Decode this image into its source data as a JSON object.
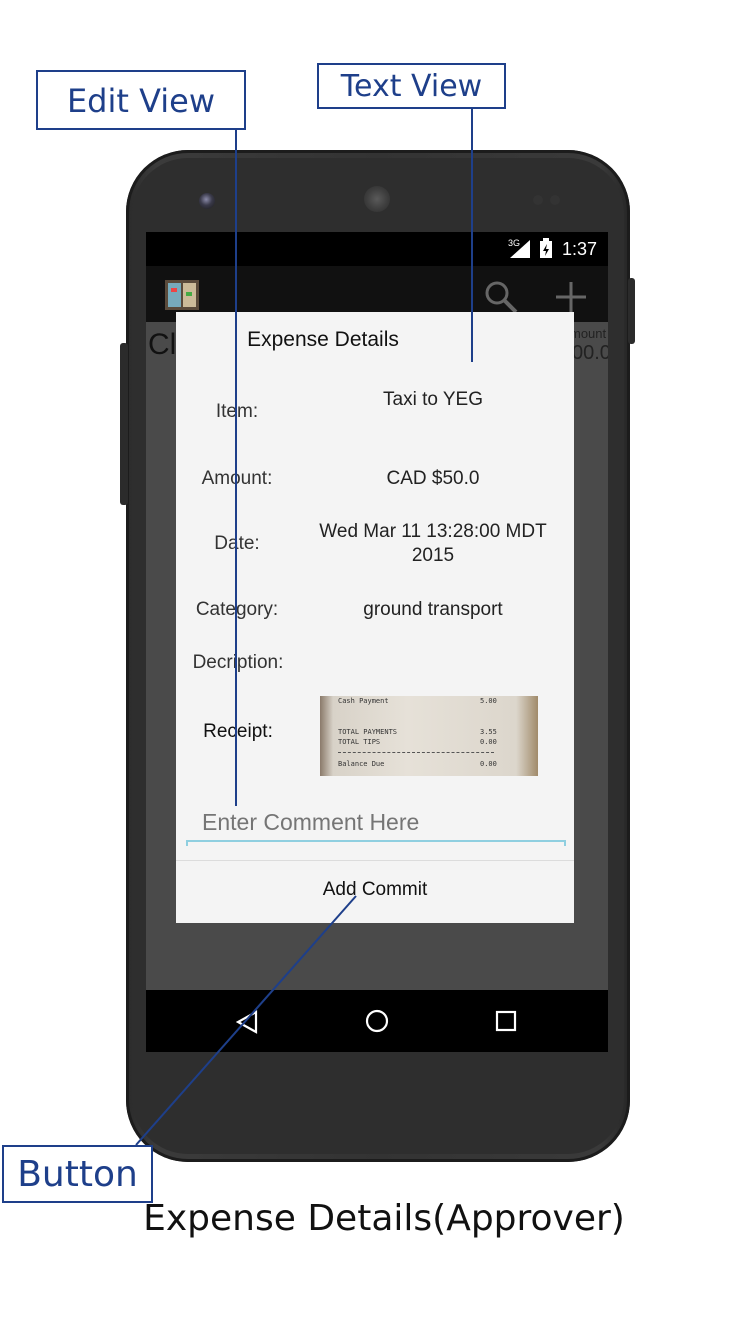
{
  "annotations": {
    "edit_view": "Edit View",
    "text_view": "Text View",
    "button": "Button",
    "caption": "Expense Details(Approver)"
  },
  "status_bar": {
    "network": "3G",
    "time": "1:37"
  },
  "background_screen": {
    "title_fragment": "Cl",
    "column_fragment": "mount",
    "value_fragment": "00.0"
  },
  "dialog": {
    "title": "Expense Details",
    "fields": {
      "item": {
        "label": "Item:",
        "value": "Taxi to YEG"
      },
      "amount": {
        "label": "Amount:",
        "value": "CAD $50.0"
      },
      "date": {
        "label": "Date:",
        "value_line1": "Wed Mar 11 13:28:00 MDT",
        "value_line2": "2015"
      },
      "category": {
        "label": "Category:",
        "value": "ground transport"
      },
      "description": {
        "label": "Decription:",
        "value": ""
      },
      "receipt": {
        "label": "Receipt:",
        "lines": [
          {
            "text": "Cash Payment",
            "amount": "5.00"
          },
          {
            "text": "TOTAL PAYMENTS",
            "amount": "3.55"
          },
          {
            "text": "TOTAL TIPS",
            "amount": "0.00"
          },
          {
            "text": "Balance Due",
            "amount": "0.00"
          }
        ]
      }
    },
    "comment": {
      "placeholder": "Enter Comment Here",
      "value": ""
    },
    "add_button": "Add Commit"
  },
  "colors": {
    "annotation_blue": "#1e3f8a",
    "input_underline": "#8fcfe0",
    "dialog_bg": "#f4f4f4"
  }
}
